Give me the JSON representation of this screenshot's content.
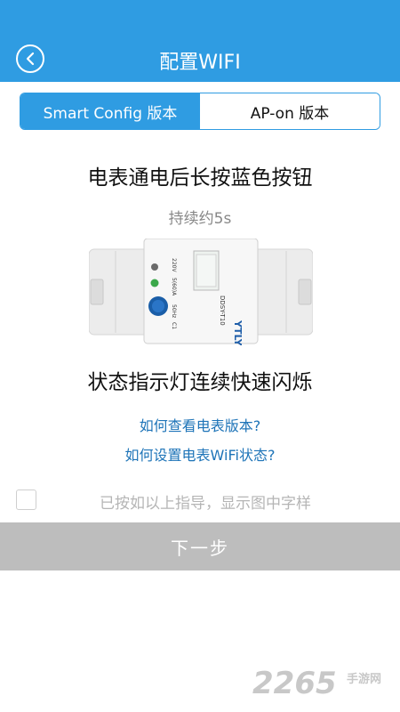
{
  "status_bar": {
    "left": "",
    "right": ""
  },
  "header": {
    "title": "配置WIFI"
  },
  "tabs": [
    {
      "label": "Smart Config 版本",
      "active": true
    },
    {
      "label": "AP-on 版本",
      "active": false
    }
  ],
  "instructions": {
    "step1": "电表通电后长按蓝色按钮",
    "duration": "持续约5s",
    "step2": "状态指示灯连续快速闪烁"
  },
  "device_image": {
    "brand": "YTLY",
    "model": "DDSY-T10",
    "spec_lines": [
      "220V",
      "5(60)A",
      "50Hz",
      "C1"
    ]
  },
  "links": {
    "check_version": "如何查看电表版本?",
    "set_wifi_state": "如何设置电表WiFi状态?"
  },
  "confirm": {
    "label": "已按如以上指导，显示图中字样",
    "checked": false
  },
  "next_button": {
    "label": "下一步"
  },
  "watermark": {
    "number": "2265",
    "cn": "手游网",
    "url": ""
  },
  "colors": {
    "primary": "#2f9ce2",
    "link": "#1e74b8",
    "disabled_button": "#bdbdbd"
  }
}
